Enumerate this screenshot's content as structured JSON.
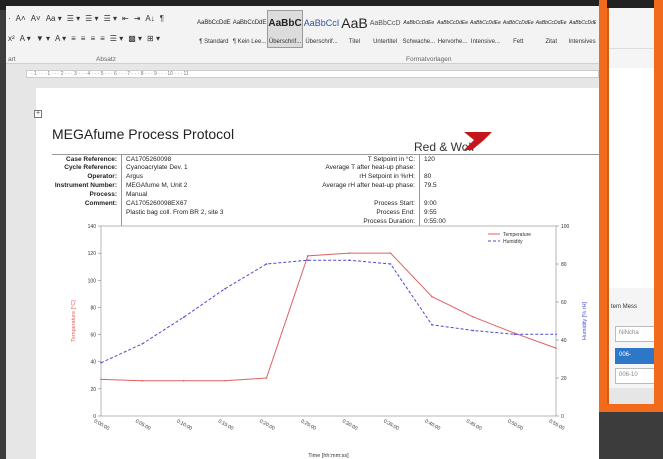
{
  "ribbon": {
    "font_row1": [
      "·",
      "A˄",
      "A˅",
      "Aa ▾",
      "☰ ▾",
      "☰ ▾",
      "☰ ▾",
      "⇤",
      "⇥",
      "A↓",
      "¶"
    ],
    "font_row2": [
      "x²",
      "A ▾",
      "▼ ▾",
      "A ▾",
      "≡",
      "≡",
      "≡",
      "≡",
      "☰ ▾",
      "▩ ▾",
      "⊞ ▾"
    ],
    "group_font": "art",
    "group_para": "Absatz",
    "group_styles": "Formatvorlagen",
    "styles": [
      {
        "preview": "AaBbCcDdE",
        "name": "¶ Standard"
      },
      {
        "preview": "AaBbCcDdE",
        "name": "¶ Kein Lee..."
      },
      {
        "preview": "AaBbC",
        "name": "Überschrif..."
      },
      {
        "preview": "AaBbCcI",
        "name": "Überschrif..."
      },
      {
        "preview": "AaB",
        "name": "Titel"
      },
      {
        "preview": "AaBbCcD",
        "name": "Untertitel"
      },
      {
        "preview": "AaBbCcDdEe",
        "name": "Schwache..."
      },
      {
        "preview": "AaBbCcDdEe",
        "name": "Hervorhe..."
      },
      {
        "preview": "AaBbCcDdEe",
        "name": "Intensive..."
      },
      {
        "preview": "AaBbCcDdEe",
        "name": "Fett"
      },
      {
        "preview": "AaBbCcDdEe",
        "name": "Zitat"
      },
      {
        "preview": "AaBbCcDdEe",
        "name": "Intensives..."
      }
    ]
  },
  "ruler": "· 1 · · · 1 · · · 2 · · · 3 · · · 4 · · · 5 · · · 6 · · · 7 · · · 8 · · · 9 · · · 10 · · · 11",
  "doc": {
    "anchor": "+",
    "title": "MEGAfume Process Protocol",
    "logo_text": "Red & Wolf",
    "left": [
      {
        "k": "Case Reference:",
        "v": "CA1705260098"
      },
      {
        "k": "Cycle Reference:",
        "v": "Cyanoacrylate Dev. 1"
      },
      {
        "k": "Operator:",
        "v": "Argus"
      },
      {
        "k": "Instrument Number:",
        "v": "MEGAfume M, Unit 2"
      },
      {
        "k": "Process:",
        "v": "Manual"
      },
      {
        "k": "Comment:",
        "v": "CA1705260098EX67"
      },
      {
        "k": "",
        "v": "Plastic bag coll. From BR 2, site 3"
      }
    ],
    "right": [
      {
        "k": "T Setpoint in °C:",
        "v": "120"
      },
      {
        "k": "Average T after heat-up phase:",
        "v": ""
      },
      {
        "k": "rH Setpoint in %rH:",
        "v": "80"
      },
      {
        "k": "Average rH after heat-up phase:",
        "v": "79.5"
      },
      {
        "k": "",
        "v": ""
      },
      {
        "k": "Process Start:",
        "v": "9:00"
      },
      {
        "k": "Process End:",
        "v": "9:55"
      },
      {
        "k": "Process Duration:",
        "v": "0:55:00"
      }
    ]
  },
  "side": {
    "msg": "tem Mess",
    "box1": "NiNcha",
    "box2": "006-",
    "box3": "006-10"
  },
  "colors": {
    "accent": "#f26a1b",
    "temp": "#e06060",
    "hum": "#4a4acc"
  },
  "chart_data": {
    "type": "line",
    "xlabel": "Time [hh:mm:ss]",
    "ylabel": "Temperature [°C]",
    "y2label": "Humidity [% rH]",
    "ylim": [
      0,
      140
    ],
    "y2lim": [
      0,
      100
    ],
    "yticks": [
      "0",
      "20",
      "40",
      "60",
      "80",
      "100",
      "120",
      "140"
    ],
    "y2ticks": [
      "0",
      "20",
      "40",
      "60",
      "80",
      "100"
    ],
    "x": [
      "0:00:00",
      "0:05:00",
      "0:10:00",
      "0:15:00",
      "0:20:00",
      "0:25:00",
      "0:30:00",
      "0:35:00",
      "0:40:00",
      "0:45:00",
      "0:50:00",
      "0:55:00"
    ],
    "series": [
      {
        "name": "Temperature",
        "axis": "left",
        "color": "#e06060",
        "values": [
          27,
          26,
          26,
          26,
          28,
          118,
          120,
          120,
          88,
          73,
          61,
          50
        ]
      },
      {
        "name": "Humidity",
        "axis": "right",
        "color": "#4a4acc",
        "values": [
          28,
          38,
          52,
          67,
          80,
          82,
          82,
          80,
          48,
          45,
          43,
          43
        ]
      }
    ]
  }
}
